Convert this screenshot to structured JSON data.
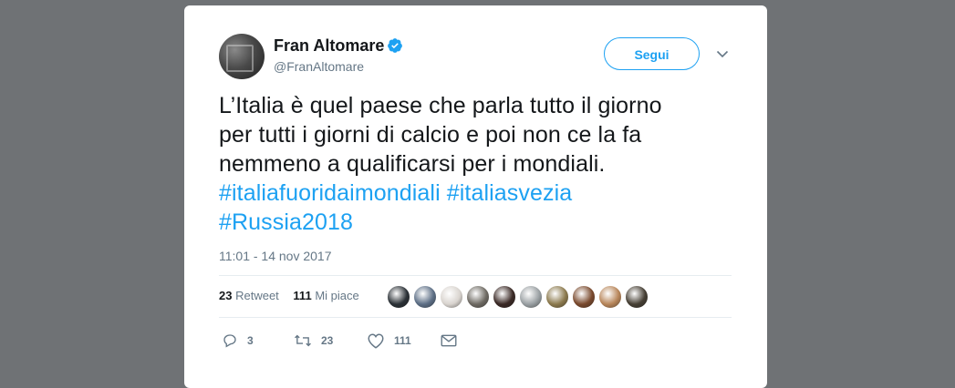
{
  "tweet": {
    "author_name": "Fran Altomare",
    "author_handle": "@FranAltomare",
    "verified": true,
    "follow_label": "Segui",
    "text_lines": [
      "L’Italia è quel paese che parla tutto il giorno",
      "per tutti i giorni di calcio e poi non ce la fa",
      "nemmeno a qualificarsi per i mondiali."
    ],
    "hashtags": [
      "#italiafuoridaimondiali",
      "#italiasvezia",
      "#Russia2018"
    ],
    "timestamp": "11:01 - 14 nov 2017"
  },
  "stats": {
    "retweets_count": "23",
    "retweets_label": "Retweet",
    "likes_count": "111",
    "likes_label": "Mi piace"
  },
  "liker_avatars": [
    {
      "color": "#2b3136"
    },
    {
      "color": "#5d6f86"
    },
    {
      "color": "#d9d4cf"
    },
    {
      "color": "#6e6a63"
    },
    {
      "color": "#3b2a26"
    },
    {
      "color": "#9aa0a3"
    },
    {
      "color": "#8c7a4e"
    },
    {
      "color": "#7a4a2e"
    },
    {
      "color": "#b8865a"
    },
    {
      "color": "#463f34"
    }
  ],
  "actions": {
    "reply_count": "3",
    "retweet_count": "23",
    "like_count": "111"
  },
  "colors": {
    "accent": "#1da1f2",
    "text": "#14171a",
    "muted": "#657786",
    "background": "#6f7275"
  }
}
